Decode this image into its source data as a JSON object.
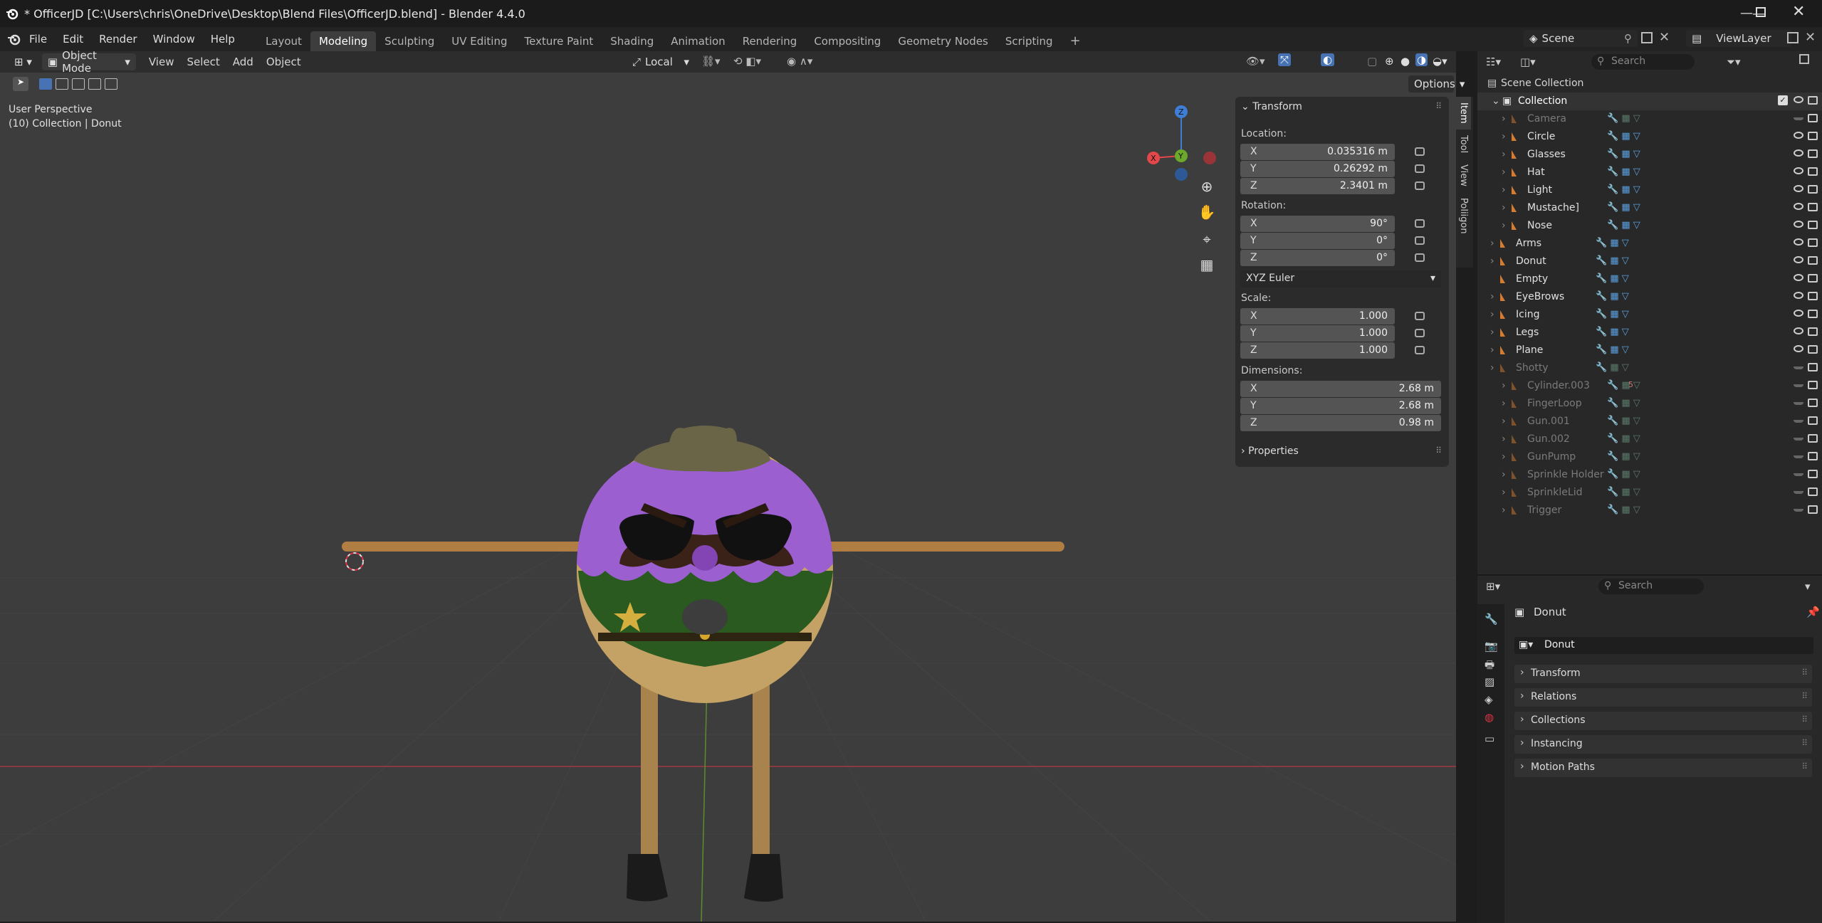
{
  "window": {
    "title": "* OfficerJD [C:\\Users\\chris\\OneDrive\\Desktop\\Blend Files\\OfficerJD.blend] - Blender 4.4.0",
    "controls": [
      "minimize-icon",
      "maximize-icon",
      "close-icon"
    ]
  },
  "menu": {
    "items": [
      "File",
      "Edit",
      "Render",
      "Window",
      "Help"
    ],
    "workspaces": [
      "Layout",
      "Modeling",
      "Sculpting",
      "UV Editing",
      "Texture Paint",
      "Shading",
      "Animation",
      "Rendering",
      "Compositing",
      "Geometry Nodes",
      "Scripting"
    ],
    "active_workspace": "Modeling",
    "add_workspace": "+",
    "scene": "Scene",
    "view_layer": "ViewLayer"
  },
  "viewport_header": {
    "mode": "Object Mode",
    "menus": [
      "View",
      "Select",
      "Add",
      "Object"
    ],
    "transform_orientation": "Local",
    "options": "Options"
  },
  "viewport": {
    "perspective": "User Perspective",
    "collection_info": "(10) Collection | Donut",
    "gizmo_axes": [
      "X",
      "Y",
      "Z"
    ]
  },
  "npanel": {
    "tabs": [
      "Item",
      "Tool",
      "View",
      "Poliigon"
    ],
    "transform_header": "Transform",
    "location_label": "Location:",
    "location": [
      {
        "axis": "X",
        "value": "0.035316 m"
      },
      {
        "axis": "Y",
        "value": "0.26292 m"
      },
      {
        "axis": "Z",
        "value": "2.3401 m"
      }
    ],
    "rotation_label": "Rotation:",
    "rotation": [
      {
        "axis": "X",
        "value": "90°"
      },
      {
        "axis": "Y",
        "value": "0°"
      },
      {
        "axis": "Z",
        "value": "0°"
      }
    ],
    "rotation_mode": "XYZ Euler",
    "scale_label": "Scale:",
    "scale": [
      {
        "axis": "X",
        "value": "1.000"
      },
      {
        "axis": "Y",
        "value": "1.000"
      },
      {
        "axis": "Z",
        "value": "1.000"
      }
    ],
    "dimensions_label": "Dimensions:",
    "dimensions": [
      {
        "axis": "X",
        "value": "2.68 m"
      },
      {
        "axis": "Y",
        "value": "2.68 m"
      },
      {
        "axis": "Z",
        "value": "0.98 m"
      }
    ],
    "properties_header": "Properties"
  },
  "outliner": {
    "search_placeholder": "Search",
    "scene_collection": "Scene Collection",
    "collection": "Collection",
    "items": [
      {
        "name": "Camera",
        "dim": true,
        "level": 2
      },
      {
        "name": "Circle",
        "dim": false,
        "level": 2
      },
      {
        "name": "Glasses",
        "dim": false,
        "level": 2
      },
      {
        "name": "Hat",
        "dim": false,
        "level": 2
      },
      {
        "name": "Light",
        "dim": false,
        "level": 2
      },
      {
        "name": "Mustache]",
        "dim": false,
        "level": 2
      },
      {
        "name": "Nose",
        "dim": false,
        "level": 2
      },
      {
        "name": "Arms",
        "dim": false,
        "level": 1
      },
      {
        "name": "Donut",
        "dim": false,
        "level": 1
      },
      {
        "name": "Empty",
        "dim": false,
        "level": 1
      },
      {
        "name": "EyeBrows",
        "dim": false,
        "level": 1
      },
      {
        "name": "Icing",
        "dim": false,
        "level": 1
      },
      {
        "name": "Legs",
        "dim": false,
        "level": 1
      },
      {
        "name": "Plane",
        "dim": false,
        "level": 1
      },
      {
        "name": "Shotty",
        "dim": true,
        "level": 1
      },
      {
        "name": "Cylinder.003",
        "dim": true,
        "level": 2
      },
      {
        "name": "FingerLoop",
        "dim": true,
        "level": 2
      },
      {
        "name": "Gun.001",
        "dim": true,
        "level": 2
      },
      {
        "name": "Gun.002",
        "dim": true,
        "level": 2
      },
      {
        "name": "GunPump",
        "dim": true,
        "level": 2
      },
      {
        "name": "Sprinkle Holder",
        "dim": true,
        "level": 2
      },
      {
        "name": "SprinkleLid",
        "dim": true,
        "level": 2
      },
      {
        "name": "Trigger",
        "dim": true,
        "level": 2
      }
    ],
    "cylinder_badge": "5"
  },
  "properties": {
    "search_placeholder": "Search",
    "object_name": "Donut",
    "object_field": "Donut",
    "sections": [
      "Transform",
      "Relations",
      "Collections",
      "Instancing",
      "Motion Paths"
    ]
  },
  "colors": {
    "accent_blue": "#4772b3",
    "axis_x": "#e2474a",
    "axis_y": "#6ba82b",
    "axis_z": "#3f7ed6",
    "object_orange": "#d57c2e",
    "donut_icing": "#9b5fd0"
  }
}
